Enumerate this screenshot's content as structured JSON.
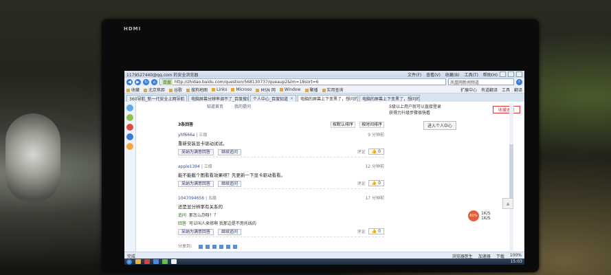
{
  "monitor": {
    "brand": "HDMI"
  },
  "window": {
    "title": "1179527440@qq.com 的安全浏览器",
    "menus": [
      "文件(F)",
      "查看(V)",
      "收藏(B)",
      "工具(T)",
      "帮助(H)"
    ]
  },
  "nav": {
    "address_tag": "百度",
    "url": "http://zhidao.baidu.com/question/568130737/queaup2&lm=18sort=6",
    "search_value": "",
    "search_placeholder": "凤凰网新闻频道"
  },
  "bookmarks": {
    "left": [
      "收藏",
      "北京焦距",
      "谷歌",
      "搜狗地图",
      "Links",
      "Microso",
      "MSN 网",
      "Window",
      "聚播",
      "实用查询"
    ],
    "right": [
      "扩展中心",
      "有道翻译",
      "工具",
      "翻译"
    ]
  },
  "tabs": [
    {
      "label": "360导航_新一代安全上网导航",
      "active": false
    },
    {
      "label": "电脑屏幕分辨率调不了_百度搜索",
      "active": false
    },
    {
      "label": "个人中心_百度知道",
      "active": false
    },
    {
      "label": "电脑的屏幕上下变黑了，想问的",
      "active": true
    },
    {
      "label": "电脑的屏幕上下变黑了，想问的",
      "active": false
    }
  ],
  "subnav": [
    "知道首页",
    "我的提问"
  ],
  "answers_header": {
    "title": "3条回答",
    "sort": [
      "按默认排序",
      "按时间排序"
    ]
  },
  "answers": [
    {
      "user": "yhf666a",
      "level": "三级",
      "time": "9 分钟前",
      "body": "重新安装显卡驱动试试。",
      "followup": null,
      "comment": "评论",
      "votes": "0"
    },
    {
      "user": "apple1394",
      "level": "三级",
      "time": "12 分钟前",
      "body": "能不能截个图看看效果呀？先更新一下显卡驱动看看。",
      "followup": null,
      "comment": "评论",
      "votes": "0"
    },
    {
      "user": "1047094656",
      "level": "五级",
      "time": "17 分钟前",
      "body": "还是显分辨率有关系的",
      "followup": {
        "q_label": "追问",
        "q_text": "那怎么办呀！？",
        "a_label": "回答",
        "a_text": "可以叫人来修啊 我那边是不用托线的"
      },
      "comment": "评论",
      "votes": "0"
    }
  ],
  "answer_buttons": [
    "采纳为满意回答",
    "继续追问"
  ],
  "share": {
    "label": "分享到："
  },
  "right_panel": {
    "line1": "5级以上用户就可以直接登录",
    "line2": "获得力升级步骤很快看",
    "center_button": "进入个人中心",
    "ad": "收藏本页"
  },
  "net_meter": {
    "percent": "60%",
    "up": "1K/S",
    "down": "1K/S"
  },
  "statusbar": {
    "left": "完成",
    "items": [
      "浏览器医生",
      "加速器",
      "下载",
      "100%"
    ]
  },
  "taskbar": {
    "clock": "15:03"
  }
}
